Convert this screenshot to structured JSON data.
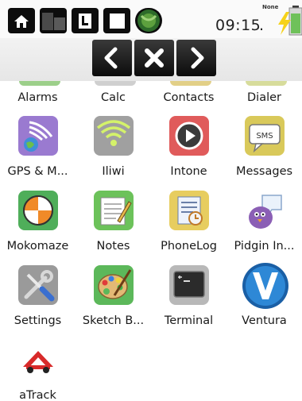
{
  "status_bar": {
    "time": "09:15",
    "network": "None",
    "indicator": "."
  },
  "nav": {
    "back": "chevron-left-icon",
    "close": "close-icon",
    "forward": "chevron-right-icon"
  },
  "apps": [
    {
      "label": "Alarms"
    },
    {
      "label": "Calc"
    },
    {
      "label": "Contacts"
    },
    {
      "label": "Dialer"
    },
    {
      "label": "GPS & M..."
    },
    {
      "label": "Iliwi"
    },
    {
      "label": "Intone"
    },
    {
      "label": "Messages"
    },
    {
      "label": "Mokomaze"
    },
    {
      "label": "Notes"
    },
    {
      "label": "PhoneLog"
    },
    {
      "label": "Pidgin In..."
    },
    {
      "label": "Settings"
    },
    {
      "label": "Sketch B..."
    },
    {
      "label": "Terminal"
    },
    {
      "label": "Ventura"
    },
    {
      "label": "aTrack"
    }
  ],
  "messages_icon_text": "SMS",
  "colors": {
    "accent_green": "#6fc15a",
    "battery_yellow": "#f6d21a"
  }
}
